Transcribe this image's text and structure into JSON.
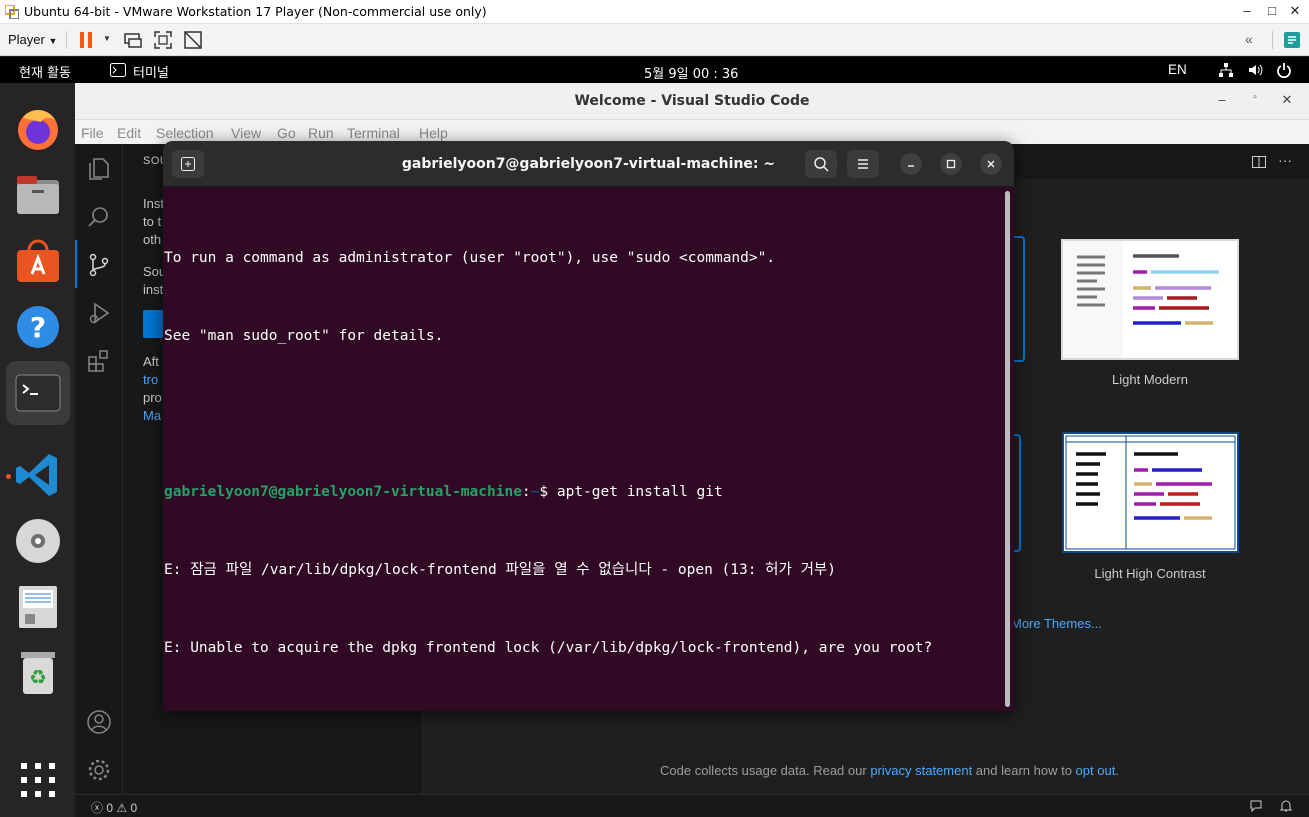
{
  "vmware": {
    "title": "Ubuntu 64-bit - VMware Workstation 17 Player (Non-commercial use only)",
    "player_menu": "Player",
    "window_controls": [
      "–",
      "□",
      "✕"
    ]
  },
  "topbar": {
    "activities": "현재 활동",
    "app_name": "터미널",
    "clock": "5월 9일  00 : 36",
    "language": "EN"
  },
  "dock": {
    "items": [
      "firefox-icon",
      "files-icon",
      "app-center-icon",
      "help-icon",
      "terminal-icon",
      "vscode-icon",
      "dvd-icon",
      "document-viewer-icon",
      "trash-icon",
      "show-apps-icon"
    ]
  },
  "vscode": {
    "title": "Welcome - Visual Studio Code",
    "menu": [
      "File",
      "Edit",
      "Selection",
      "View",
      "Go",
      "Run",
      "Terminal",
      "Help"
    ],
    "sidebar": {
      "header": "SOU",
      "lines": [
        "Inst",
        "to t",
        "oth",
        "Sou",
        "inst",
        "Aft",
        "tro",
        "pro",
        "Ma"
      ]
    },
    "themes": [
      {
        "label": "Light Modern"
      },
      {
        "label": "Light High Contrast"
      }
    ],
    "more_themes": "More Themes...",
    "footer": {
      "prefix": "Code collects usage data. Read our ",
      "privacy_link": "privacy statement",
      "middle": " and learn how to ",
      "opt_out_link": "opt out",
      "suffix": "."
    },
    "status": {
      "errors": "0",
      "warnings": "0"
    }
  },
  "terminal": {
    "title": "gabrielyoon7@gabrielyoon7-virtual-machine: ~",
    "lines": {
      "l1": "To run a command as administrator (user \"root\"), use \"sudo <command>\".",
      "l2": "See \"man sudo_root\" for details.",
      "prompt_user": "gabrielyoon7@gabrielyoon7-virtual-machine",
      "prompt_colon": ":",
      "prompt_path": "~",
      "prompt_dollar": "$ ",
      "command": "apt-get install git",
      "err1": "E: 잠금 파일 /var/lib/dpkg/lock-frontend 파일을 열 수 없습니다 - open (13: 허가 거부)",
      "err2": "E: Unable to acquire the dpkg frontend lock (/var/lib/dpkg/lock-frontend), are you root?"
    }
  }
}
